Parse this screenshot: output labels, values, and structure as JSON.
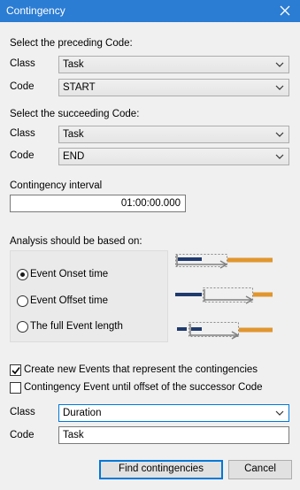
{
  "window": {
    "title": "Contingency",
    "close_glyph": "close-icon"
  },
  "preceding": {
    "heading": "Select the preceding Code:",
    "class_label": "Class",
    "class_value": "Task",
    "code_label": "Code",
    "code_value": "START"
  },
  "succeeding": {
    "heading": "Select the succeeding Code:",
    "class_label": "Class",
    "class_value": "Task",
    "code_label": "Code",
    "code_value": "END"
  },
  "interval": {
    "label": "Contingency interval",
    "value": "01:00:00.000"
  },
  "analysis": {
    "heading": "Analysis should be based on:",
    "options": [
      {
        "label": "Event Onset time",
        "selected": true
      },
      {
        "label": "Event Offset time",
        "selected": false
      },
      {
        "label": "The full Event length",
        "selected": false
      }
    ]
  },
  "options": {
    "create_events": {
      "label": "Create new Events that represent the contingencies",
      "checked": true
    },
    "until_offset": {
      "label": "Contingency Event until offset of the successor Code",
      "checked": false
    }
  },
  "result": {
    "class_label": "Class",
    "class_value": "Duration",
    "code_label": "Code",
    "code_value": "Task"
  },
  "buttons": {
    "find": "Find contingencies",
    "cancel": "Cancel"
  },
  "colors": {
    "titlebar": "#2b7cd3",
    "preceding_bar": "#1f3a6e",
    "succeeding_bar": "#e0962f",
    "arrow": "#808080",
    "focus_blue": "#0078d7"
  }
}
